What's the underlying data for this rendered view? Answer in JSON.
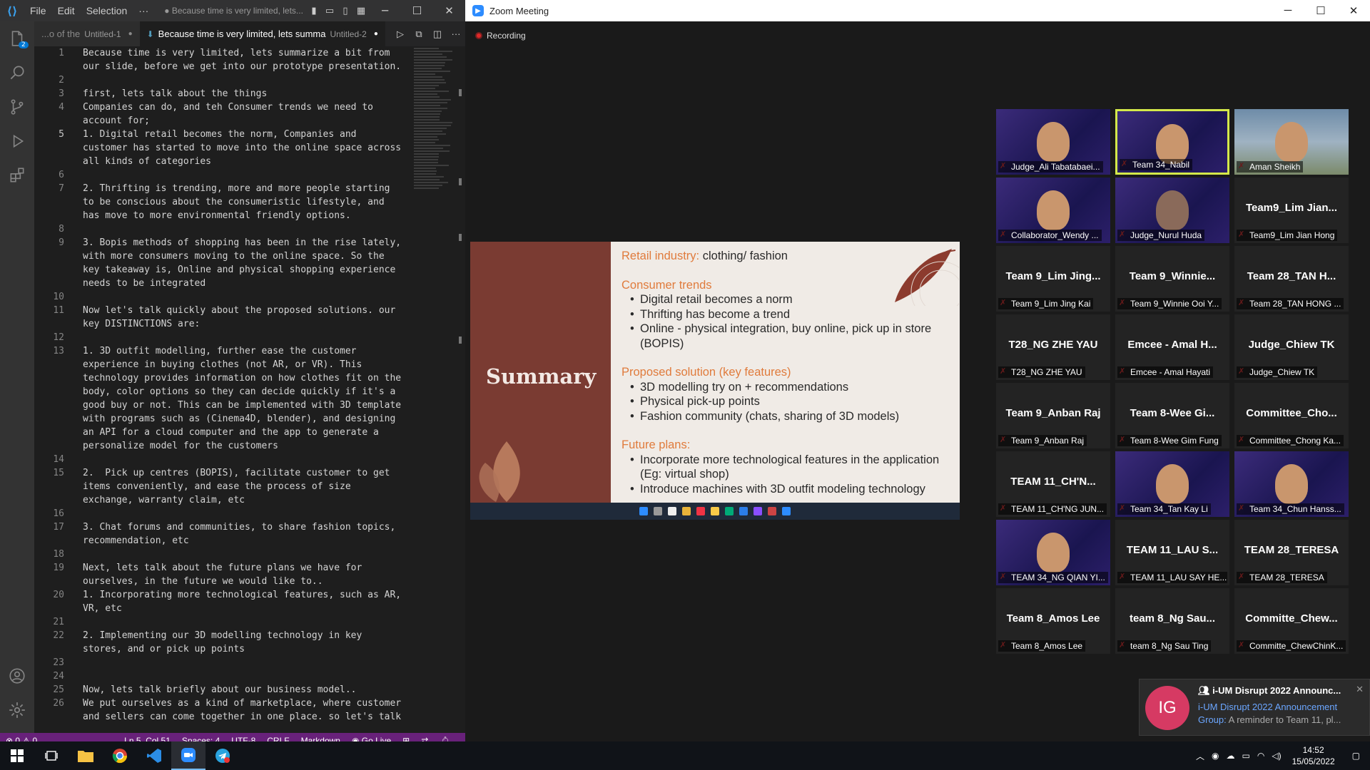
{
  "vscode": {
    "menu": [
      "File",
      "Edit",
      "Selection",
      "···"
    ],
    "window_title": "● Because time is very limited, lets...",
    "tabs": [
      {
        "label": "...o of the",
        "sub": "Untitled-1",
        "modified": "●"
      },
      {
        "label": "Because time is very limited, lets summa",
        "sub": "Untitled-2",
        "modified": "●"
      }
    ],
    "scm_badge": "2",
    "lines": [
      {
        "n": "1",
        "t": "Because time is very limited, lets summarize a bit from"
      },
      {
        "n": "",
        "t": "our slide, before we get into our prototype presentation."
      },
      {
        "n": "2",
        "t": ""
      },
      {
        "n": "3",
        "t": "first, lets talk about the things"
      },
      {
        "n": "4",
        "t": "Companies can do, and teh Consumer trends we need to"
      },
      {
        "n": "",
        "t": "account for;"
      },
      {
        "n": "5",
        "t": "1. Digital retail becomes the norm, Companies and"
      },
      {
        "n": "",
        "t": "customer has started to move into the online space across"
      },
      {
        "n": "",
        "t": "all kinds of categories"
      },
      {
        "n": "6",
        "t": ""
      },
      {
        "n": "7",
        "t": "2. Thrifting is trending, more and more people starting"
      },
      {
        "n": "",
        "t": "to be conscious about the consumeristic lifestyle, and"
      },
      {
        "n": "",
        "t": "has move to more environmental friendly options."
      },
      {
        "n": "8",
        "t": ""
      },
      {
        "n": "9",
        "t": "3. Bopis methods of shopping has been in the rise lately,"
      },
      {
        "n": "",
        "t": "with more consumers moving to the online space. So the"
      },
      {
        "n": "",
        "t": "key takeaway is, Online and physical shopping experience"
      },
      {
        "n": "",
        "t": "needs to be integrated"
      },
      {
        "n": "10",
        "t": ""
      },
      {
        "n": "11",
        "t": "Now let's talk quickly about the proposed solutions. our"
      },
      {
        "n": "",
        "t": "key DISTINCTIONS are:"
      },
      {
        "n": "12",
        "t": ""
      },
      {
        "n": "13",
        "t": "1. 3D outfit modelling, further ease the customer"
      },
      {
        "n": "",
        "t": "experience in buying clothes (not AR, or VR). This"
      },
      {
        "n": "",
        "t": "technology provides information on how clothes fit on the"
      },
      {
        "n": "",
        "t": "body, color options so they can decide quickly if it's a"
      },
      {
        "n": "",
        "t": "good buy or not. This can be implemented with 3D template"
      },
      {
        "n": "",
        "t": "with programs such as (Cinema4D, blender), and designing"
      },
      {
        "n": "",
        "t": "an API for a cloud computer and the app to generate a"
      },
      {
        "n": "",
        "t": "personalize model for the customers"
      },
      {
        "n": "14",
        "t": ""
      },
      {
        "n": "15",
        "t": "2.  Pick up centres (BOPIS), facilitate customer to get"
      },
      {
        "n": "",
        "t": "items conveniently, and ease the process of size"
      },
      {
        "n": "",
        "t": "exchange, warranty claim, etc"
      },
      {
        "n": "16",
        "t": ""
      },
      {
        "n": "17",
        "t": "3. Chat forums and communities, to share fashion topics,"
      },
      {
        "n": "",
        "t": "recommendation, etc"
      },
      {
        "n": "18",
        "t": ""
      },
      {
        "n": "19",
        "t": "Next, lets talk about the future plans we have for"
      },
      {
        "n": "",
        "t": "ourselves, in the future we would like to.."
      },
      {
        "n": "20",
        "t": "1. Incorporating more technological features, such as AR,"
      },
      {
        "n": "",
        "t": "VR, etc"
      },
      {
        "n": "21",
        "t": ""
      },
      {
        "n": "22",
        "t": "2. Implementing our 3D modelling technology in key"
      },
      {
        "n": "",
        "t": "stores, and or pick up points"
      },
      {
        "n": "23",
        "t": ""
      },
      {
        "n": "24",
        "t": ""
      },
      {
        "n": "25",
        "t": "Now, lets talk briefly about our business model.."
      },
      {
        "n": "26",
        "t": "We put ourselves as a kind of marketplace, where customer"
      },
      {
        "n": "",
        "t": "and sellers can come together in one place. so let's talk"
      }
    ],
    "status": {
      "problems": "⊗ 0 ⚠ 0",
      "cursor": "Ln 5, Col 51",
      "spaces": "Spaces: 4",
      "encoding": "UTF-8",
      "eol": "CRLF",
      "language": "Markdown",
      "golive": "Go Live"
    }
  },
  "zoom": {
    "title": "Zoom Meeting",
    "recording": "Recording",
    "slide": {
      "title": "Summary",
      "sections": [
        {
          "heading": "Retail industry:",
          "inline": " clothing/ fashion",
          "bullets": []
        },
        {
          "heading": "Consumer trends",
          "inline": "",
          "bullets": [
            "Digital retail becomes a norm",
            "Thrifting has become a trend",
            "Online - physical integration, buy online, pick up in store (BOPIS)"
          ]
        },
        {
          "heading": "Proposed solution (key features)",
          "inline": "",
          "bullets": [
            "3D modelling try on + recommendations",
            "Physical pick-up points",
            "Fashion community (chats, sharing of 3D models)"
          ]
        },
        {
          "heading": "Future plans:",
          "inline": "",
          "bullets": [
            "Incorporate more technological features in the application (Eg: virtual shop)",
            "Introduce machines with 3D outfit modeling technology"
          ]
        }
      ]
    },
    "participants": [
      {
        "big": "",
        "name": "Judge_Ali Tabatabaei...",
        "kind": "vid"
      },
      {
        "big": "",
        "name": "Team 34_Nabil",
        "kind": "vid-hl"
      },
      {
        "big": "",
        "name": "Aman Sheikh",
        "kind": "city"
      },
      {
        "big": "",
        "name": "Collaborator_Wendy ...",
        "kind": "vid"
      },
      {
        "big": "",
        "name": "Judge_Nurul Huda",
        "kind": "vid-hijab"
      },
      {
        "big": "Team9_Lim Jian...",
        "name": "Team9_Lim Jian Hong",
        "kind": "name"
      },
      {
        "big": "Team 9_Lim Jing...",
        "name": "Team 9_Lim Jing Kai",
        "kind": "name"
      },
      {
        "big": "Team 9_Winnie...",
        "name": "Team 9_Winnie Ooi Y...",
        "kind": "name"
      },
      {
        "big": "Team 28_TAN H...",
        "name": "Team 28_TAN HONG ...",
        "kind": "name"
      },
      {
        "big": "T28_NG ZHE YAU",
        "name": "T28_NG ZHE YAU",
        "kind": "name"
      },
      {
        "big": "Emcee - Amal H...",
        "name": "Emcee - Amal Hayati",
        "kind": "name"
      },
      {
        "big": "Judge_Chiew TK",
        "name": "Judge_Chiew TK",
        "kind": "name"
      },
      {
        "big": "Team 9_Anban Raj",
        "name": "Team 9_Anban Raj",
        "kind": "name"
      },
      {
        "big": "Team 8-Wee Gi...",
        "name": "Team 8-Wee Gim Fung",
        "kind": "name"
      },
      {
        "big": "Committee_Cho...",
        "name": "Committee_Chong Ka...",
        "kind": "name"
      },
      {
        "big": "TEAM 11_CH'N...",
        "name": "TEAM 11_CH'NG JUN...",
        "kind": "name"
      },
      {
        "big": "",
        "name": "Team 34_Tan Kay Li",
        "kind": "vid"
      },
      {
        "big": "",
        "name": "Team 34_Chun Hanss...",
        "kind": "vid"
      },
      {
        "big": "",
        "name": "TEAM 34_NG QIAN YI...",
        "kind": "vid"
      },
      {
        "big": "TEAM 11_LAU S...",
        "name": "TEAM 11_LAU SAY HE...",
        "kind": "name"
      },
      {
        "big": "TEAM 28_TERESA",
        "name": "TEAM 28_TERESA",
        "kind": "name"
      },
      {
        "big": "Team 8_Amos Lee",
        "name": "Team 8_Amos Lee",
        "kind": "name"
      },
      {
        "big": "team 8_Ng Sau...",
        "name": "team 8_Ng Sau Ting",
        "kind": "name"
      },
      {
        "big": "Committe_Chew...",
        "name": "Committe_ChewChinK...",
        "kind": "name"
      }
    ],
    "toast": {
      "initials": "IG",
      "title": "i-UM Disrupt 2022 Announc...",
      "group": "i-UM Disrupt 2022 Announcement Group:",
      "message": " A reminder to Team 11, pl..."
    }
  },
  "taskbar": {
    "time": "14:52",
    "date": "15/05/2022"
  }
}
